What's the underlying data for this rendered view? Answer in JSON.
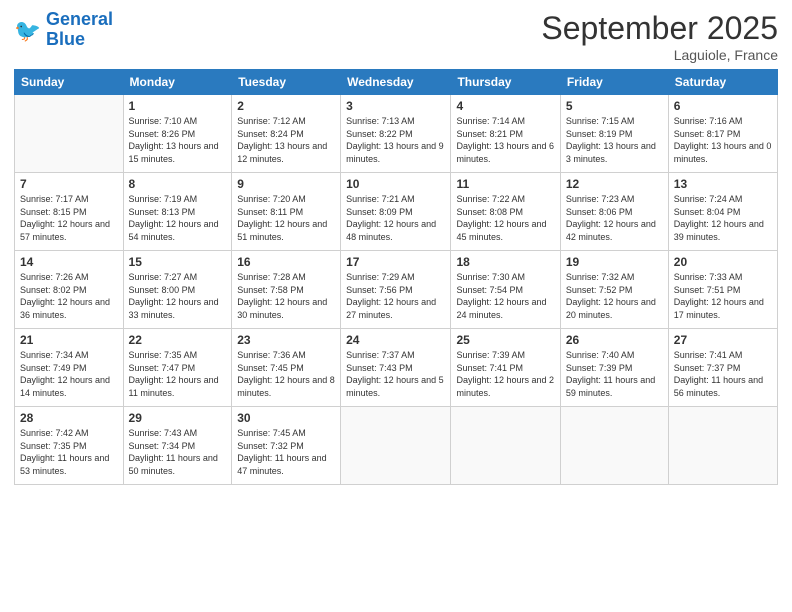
{
  "header": {
    "logo_line1": "General",
    "logo_line2": "Blue",
    "month_title": "September 2025",
    "location": "Laguiole, France"
  },
  "weekdays": [
    "Sunday",
    "Monday",
    "Tuesday",
    "Wednesday",
    "Thursday",
    "Friday",
    "Saturday"
  ],
  "weeks": [
    [
      {
        "day": "",
        "sunrise": "",
        "sunset": "",
        "daylight": ""
      },
      {
        "day": "1",
        "sunrise": "Sunrise: 7:10 AM",
        "sunset": "Sunset: 8:26 PM",
        "daylight": "Daylight: 13 hours and 15 minutes."
      },
      {
        "day": "2",
        "sunrise": "Sunrise: 7:12 AM",
        "sunset": "Sunset: 8:24 PM",
        "daylight": "Daylight: 13 hours and 12 minutes."
      },
      {
        "day": "3",
        "sunrise": "Sunrise: 7:13 AM",
        "sunset": "Sunset: 8:22 PM",
        "daylight": "Daylight: 13 hours and 9 minutes."
      },
      {
        "day": "4",
        "sunrise": "Sunrise: 7:14 AM",
        "sunset": "Sunset: 8:21 PM",
        "daylight": "Daylight: 13 hours and 6 minutes."
      },
      {
        "day": "5",
        "sunrise": "Sunrise: 7:15 AM",
        "sunset": "Sunset: 8:19 PM",
        "daylight": "Daylight: 13 hours and 3 minutes."
      },
      {
        "day": "6",
        "sunrise": "Sunrise: 7:16 AM",
        "sunset": "Sunset: 8:17 PM",
        "daylight": "Daylight: 13 hours and 0 minutes."
      }
    ],
    [
      {
        "day": "7",
        "sunrise": "Sunrise: 7:17 AM",
        "sunset": "Sunset: 8:15 PM",
        "daylight": "Daylight: 12 hours and 57 minutes."
      },
      {
        "day": "8",
        "sunrise": "Sunrise: 7:19 AM",
        "sunset": "Sunset: 8:13 PM",
        "daylight": "Daylight: 12 hours and 54 minutes."
      },
      {
        "day": "9",
        "sunrise": "Sunrise: 7:20 AM",
        "sunset": "Sunset: 8:11 PM",
        "daylight": "Daylight: 12 hours and 51 minutes."
      },
      {
        "day": "10",
        "sunrise": "Sunrise: 7:21 AM",
        "sunset": "Sunset: 8:09 PM",
        "daylight": "Daylight: 12 hours and 48 minutes."
      },
      {
        "day": "11",
        "sunrise": "Sunrise: 7:22 AM",
        "sunset": "Sunset: 8:08 PM",
        "daylight": "Daylight: 12 hours and 45 minutes."
      },
      {
        "day": "12",
        "sunrise": "Sunrise: 7:23 AM",
        "sunset": "Sunset: 8:06 PM",
        "daylight": "Daylight: 12 hours and 42 minutes."
      },
      {
        "day": "13",
        "sunrise": "Sunrise: 7:24 AM",
        "sunset": "Sunset: 8:04 PM",
        "daylight": "Daylight: 12 hours and 39 minutes."
      }
    ],
    [
      {
        "day": "14",
        "sunrise": "Sunrise: 7:26 AM",
        "sunset": "Sunset: 8:02 PM",
        "daylight": "Daylight: 12 hours and 36 minutes."
      },
      {
        "day": "15",
        "sunrise": "Sunrise: 7:27 AM",
        "sunset": "Sunset: 8:00 PM",
        "daylight": "Daylight: 12 hours and 33 minutes."
      },
      {
        "day": "16",
        "sunrise": "Sunrise: 7:28 AM",
        "sunset": "Sunset: 7:58 PM",
        "daylight": "Daylight: 12 hours and 30 minutes."
      },
      {
        "day": "17",
        "sunrise": "Sunrise: 7:29 AM",
        "sunset": "Sunset: 7:56 PM",
        "daylight": "Daylight: 12 hours and 27 minutes."
      },
      {
        "day": "18",
        "sunrise": "Sunrise: 7:30 AM",
        "sunset": "Sunset: 7:54 PM",
        "daylight": "Daylight: 12 hours and 24 minutes."
      },
      {
        "day": "19",
        "sunrise": "Sunrise: 7:32 AM",
        "sunset": "Sunset: 7:52 PM",
        "daylight": "Daylight: 12 hours and 20 minutes."
      },
      {
        "day": "20",
        "sunrise": "Sunrise: 7:33 AM",
        "sunset": "Sunset: 7:51 PM",
        "daylight": "Daylight: 12 hours and 17 minutes."
      }
    ],
    [
      {
        "day": "21",
        "sunrise": "Sunrise: 7:34 AM",
        "sunset": "Sunset: 7:49 PM",
        "daylight": "Daylight: 12 hours and 14 minutes."
      },
      {
        "day": "22",
        "sunrise": "Sunrise: 7:35 AM",
        "sunset": "Sunset: 7:47 PM",
        "daylight": "Daylight: 12 hours and 11 minutes."
      },
      {
        "day": "23",
        "sunrise": "Sunrise: 7:36 AM",
        "sunset": "Sunset: 7:45 PM",
        "daylight": "Daylight: 12 hours and 8 minutes."
      },
      {
        "day": "24",
        "sunrise": "Sunrise: 7:37 AM",
        "sunset": "Sunset: 7:43 PM",
        "daylight": "Daylight: 12 hours and 5 minutes."
      },
      {
        "day": "25",
        "sunrise": "Sunrise: 7:39 AM",
        "sunset": "Sunset: 7:41 PM",
        "daylight": "Daylight: 12 hours and 2 minutes."
      },
      {
        "day": "26",
        "sunrise": "Sunrise: 7:40 AM",
        "sunset": "Sunset: 7:39 PM",
        "daylight": "Daylight: 11 hours and 59 minutes."
      },
      {
        "day": "27",
        "sunrise": "Sunrise: 7:41 AM",
        "sunset": "Sunset: 7:37 PM",
        "daylight": "Daylight: 11 hours and 56 minutes."
      }
    ],
    [
      {
        "day": "28",
        "sunrise": "Sunrise: 7:42 AM",
        "sunset": "Sunset: 7:35 PM",
        "daylight": "Daylight: 11 hours and 53 minutes."
      },
      {
        "day": "29",
        "sunrise": "Sunrise: 7:43 AM",
        "sunset": "Sunset: 7:34 PM",
        "daylight": "Daylight: 11 hours and 50 minutes."
      },
      {
        "day": "30",
        "sunrise": "Sunrise: 7:45 AM",
        "sunset": "Sunset: 7:32 PM",
        "daylight": "Daylight: 11 hours and 47 minutes."
      },
      {
        "day": "",
        "sunrise": "",
        "sunset": "",
        "daylight": ""
      },
      {
        "day": "",
        "sunrise": "",
        "sunset": "",
        "daylight": ""
      },
      {
        "day": "",
        "sunrise": "",
        "sunset": "",
        "daylight": ""
      },
      {
        "day": "",
        "sunrise": "",
        "sunset": "",
        "daylight": ""
      }
    ]
  ]
}
